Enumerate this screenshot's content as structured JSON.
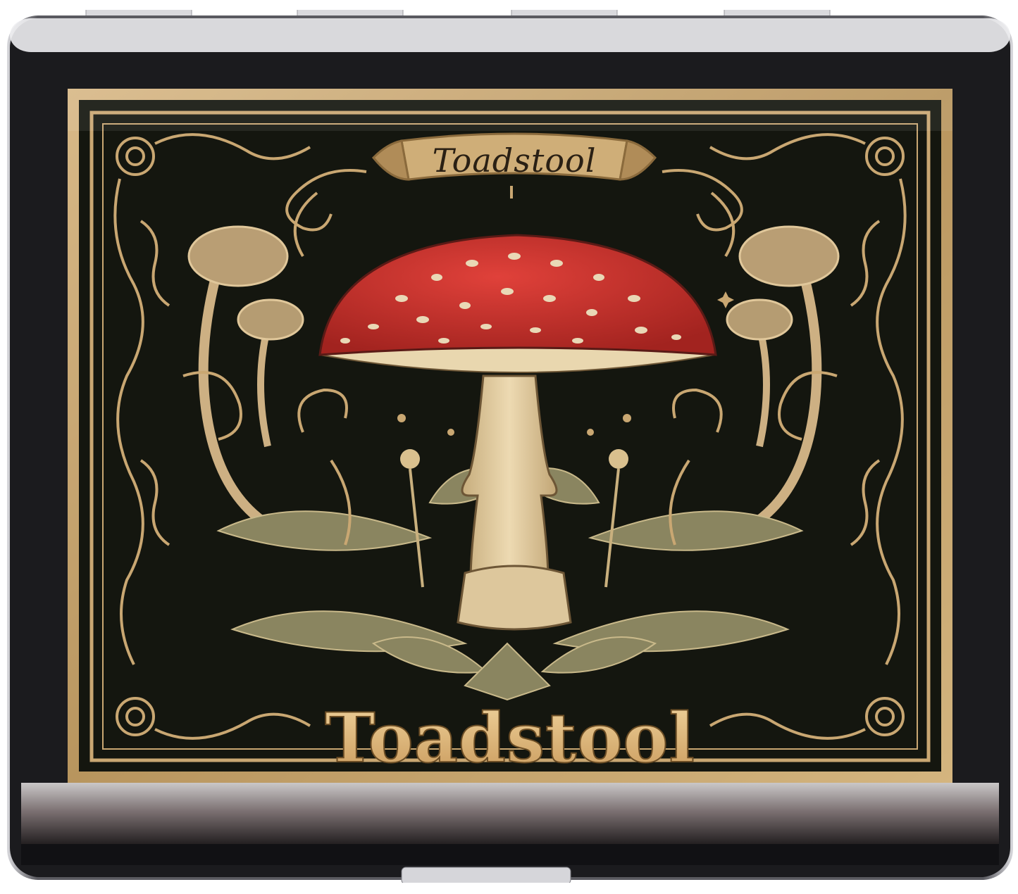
{
  "product": {
    "banner_label": "Toadstool",
    "title": "Toadstool"
  },
  "colors": {
    "background": "#ffffff",
    "case_chrome": "#c9c9cd",
    "panel_black": "#141611",
    "gold": "#c9a772",
    "gold_dark": "#8a6a3c",
    "cap_red": "#c9302a",
    "stem_cream": "#e3cfa4",
    "leaf_olive": "#8a8560"
  },
  "icons": {
    "main_subject": "amanita-mushroom-illustration",
    "side_subjects": "small-mushroom-illustration",
    "border": "ornamental-gold-frame"
  }
}
